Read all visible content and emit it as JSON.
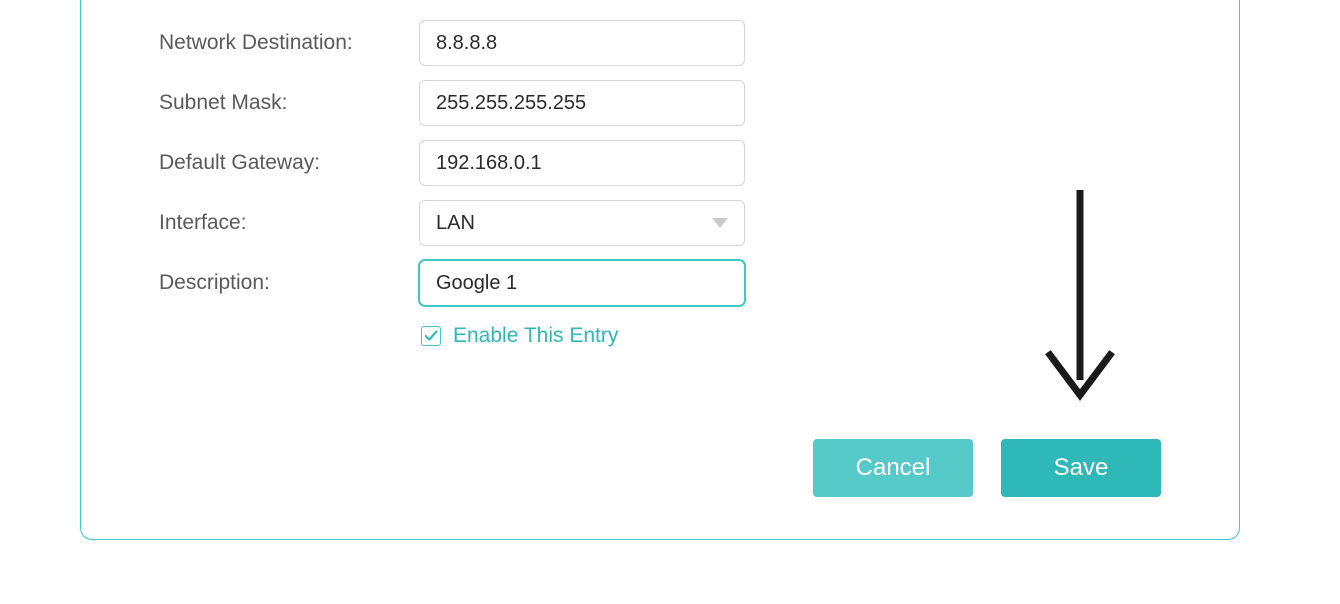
{
  "form": {
    "network_destination": {
      "label": "Network Destination:",
      "value": "8.8.8.8"
    },
    "subnet_mask": {
      "label": "Subnet Mask:",
      "value": "255.255.255.255"
    },
    "default_gateway": {
      "label": "Default Gateway:",
      "value": "192.168.0.1"
    },
    "interface": {
      "label": "Interface:",
      "value": "LAN"
    },
    "description": {
      "label": "Description:",
      "value": "Google 1"
    },
    "enable_entry": {
      "label": "Enable This Entry",
      "checked": true
    }
  },
  "buttons": {
    "cancel": "Cancel",
    "save": "Save"
  },
  "colors": {
    "accent": "#3ec8c8",
    "btn_primary": "#2fb8b8",
    "btn_secondary": "#56c9c9"
  }
}
